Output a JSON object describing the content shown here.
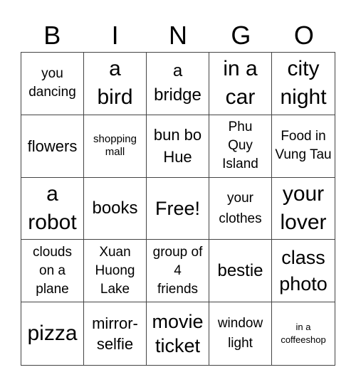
{
  "header": [
    "B",
    "I",
    "N",
    "G",
    "O"
  ],
  "cells": [
    "you dancing",
    "a bird",
    "a bridge",
    "in a car",
    "city night",
    "flowers",
    "shopping mall",
    "bun bo Hue",
    "Phu Quy Island",
    "Food in Vung Tau",
    "a robot",
    "books",
    "Free!",
    "your clothes",
    "your lover",
    "clouds on a plane",
    "Xuan Huong Lake",
    "group of 4 friends",
    "bestie",
    "class photo",
    "pizza",
    "mirror-selfie",
    "movie ticket",
    "window light",
    "in a coffeeshop"
  ]
}
